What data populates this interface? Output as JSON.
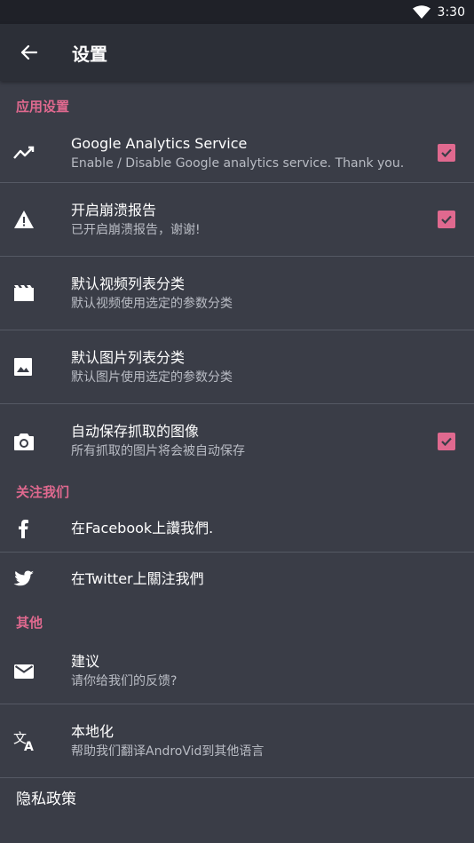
{
  "statusbar": {
    "time": "3:30"
  },
  "appbar": {
    "title": "设置"
  },
  "sections": {
    "app_settings": "应用设置",
    "follow_us": "关注我们",
    "other": "其他"
  },
  "items": {
    "analytics": {
      "primary": "Google Analytics Service",
      "secondary": "Enable / Disable Google analytics service. Thank you.",
      "checked": true
    },
    "crash": {
      "primary": "开启崩溃报告",
      "secondary": "已开启崩溃报告，谢谢!",
      "checked": true
    },
    "video_sort": {
      "primary": "默认视频列表分类",
      "secondary": "默认视频使用选定的参数分类"
    },
    "image_sort": {
      "primary": "默认图片列表分类",
      "secondary": "默认图片使用选定的参数分类"
    },
    "autosave": {
      "primary": "自动保存抓取的图像",
      "secondary": "所有抓取的图片将会被自动保存",
      "checked": true
    },
    "facebook": {
      "primary": "在Facebook上讚我們."
    },
    "twitter": {
      "primary": "在Twitter上關注我們"
    },
    "feedback": {
      "primary": "建议",
      "secondary": "请你给我们的反馈?"
    },
    "localize": {
      "primary": "本地化",
      "secondary": "帮助我们翻译AndroVid到其他语言"
    },
    "privacy": {
      "primary": "隐私政策"
    }
  },
  "colors": {
    "accent": "#e0698f",
    "background": "#3a3d47",
    "appbar": "#2c2f37",
    "statusbar": "#1f2128"
  },
  "icons": [
    "wifi-icon",
    "back-arrow-icon",
    "trending-icon",
    "warning-icon",
    "movie-icon",
    "image-icon",
    "camera-icon",
    "facebook-icon",
    "twitter-icon",
    "mail-icon",
    "translate-icon",
    "checkbox-checked-icon"
  ]
}
